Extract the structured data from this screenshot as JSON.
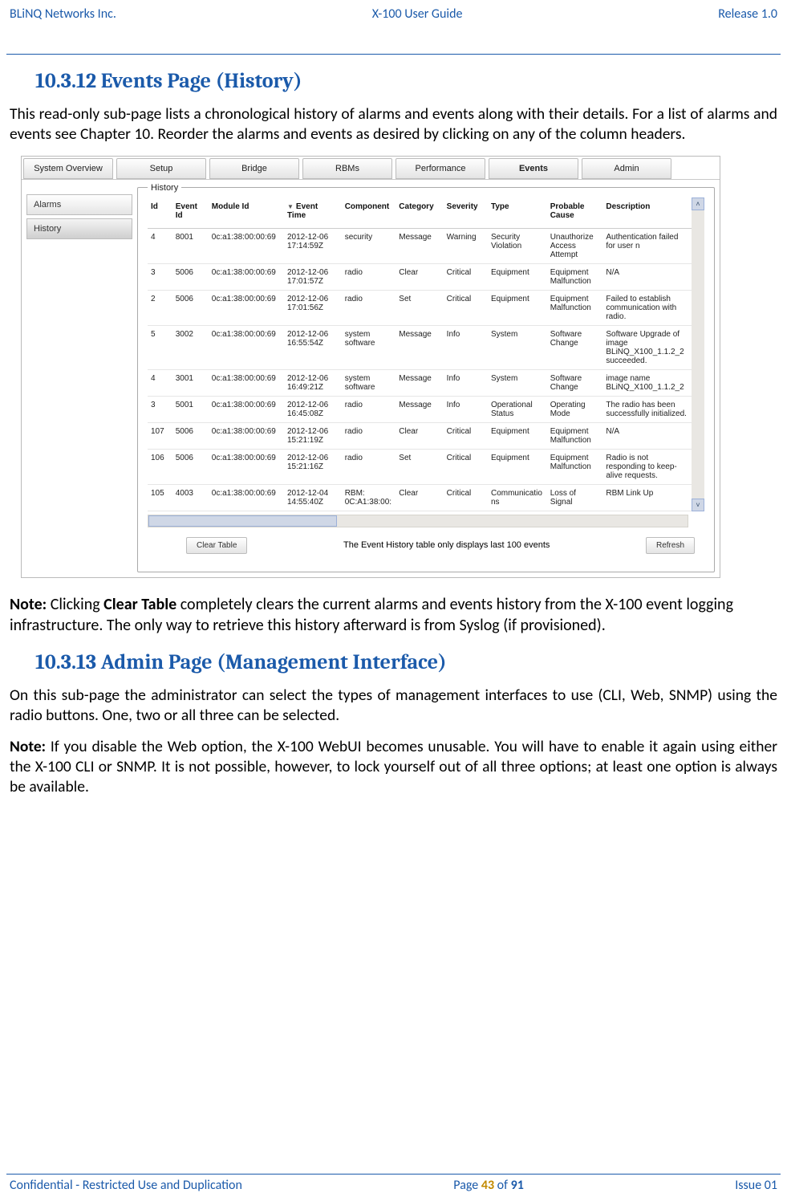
{
  "header": {
    "left": "BLiNQ Networks Inc.",
    "center": "X-100 User Guide",
    "right": "Release 1.0"
  },
  "footer": {
    "left": "Confidential - Restricted Use and Duplication",
    "page_label_pre": "Page ",
    "page_num": "43",
    "page_of": " of ",
    "page_total": "91",
    "right": "Issue 01"
  },
  "section1": {
    "heading": "10.3.12 Events Page (History)",
    "para": "This read-only sub-page lists a chronological history of alarms and events along with their details. For a list of alarms and events see Chapter 10. Reorder the alarms and events as desired by clicking on any of the column headers."
  },
  "note1": {
    "label": "Note:",
    "t1": " Clicking ",
    "bold1": "Clear Table",
    "t2": " completely clears the current alarms and events history from the X-100 event logging infrastructure. The only way to retrieve this history afterward is from Syslog (if provisioned)."
  },
  "section2": {
    "heading": "10.3.13 Admin Page (Management Interface)",
    "para": "On this sub-page the administrator can select the types of management interfaces to use (CLI, Web, SNMP) using the radio buttons. One, two or all three can be selected."
  },
  "note2": {
    "label": "Note:",
    "rest": " If you disable the Web option, the X-100 WebUI becomes unusable. You will have to enable it again using either the X-100 CLI or SNMP. It is not possible, however, to lock yourself out of all three options; at least one option is always be available."
  },
  "shot": {
    "tabs": [
      "System Overview",
      "Setup",
      "Bridge",
      "RBMs",
      "Performance",
      "Events",
      "Admin"
    ],
    "side": {
      "alarms": "Alarms",
      "history": "History"
    },
    "legend": "History",
    "cols": [
      "Id",
      "Event Id",
      "Module Id",
      "Event Time",
      "Component",
      "Category",
      "Severity",
      "Type",
      "Probable Cause",
      "Description"
    ],
    "rows": [
      {
        "id": "4",
        "eid": "8001",
        "mod": "0c:a1:38:00:00:69",
        "time": "2012-12-06 17:14:59Z",
        "comp": "security",
        "cat": "Message",
        "sev": "Warning",
        "type": "Security Violation",
        "pc": "Unauthorize Access Attempt",
        "desc": "Authentication failed for user n"
      },
      {
        "id": "3",
        "eid": "5006",
        "mod": "0c:a1:38:00:00:69",
        "time": "2012-12-06 17:01:57Z",
        "comp": "radio",
        "cat": "Clear",
        "sev": "Critical",
        "type": "Equipment",
        "pc": "Equipment Malfunction",
        "desc": "N/A"
      },
      {
        "id": "2",
        "eid": "5006",
        "mod": "0c:a1:38:00:00:69",
        "time": "2012-12-06 17:01:56Z",
        "comp": "radio",
        "cat": "Set",
        "sev": "Critical",
        "type": "Equipment",
        "pc": "Equipment Malfunction",
        "desc": "Failed to establish communication with radio."
      },
      {
        "id": "5",
        "eid": "3002",
        "mod": "0c:a1:38:00:00:69",
        "time": "2012-12-06 16:55:54Z",
        "comp": "system software",
        "cat": "Message",
        "sev": "Info",
        "type": "System",
        "pc": "Software Change",
        "desc": "Software Upgrade of image BLiNQ_X100_1.1.2_2 succeeded."
      },
      {
        "id": "4",
        "eid": "3001",
        "mod": "0c:a1:38:00:00:69",
        "time": "2012-12-06 16:49:21Z",
        "comp": "system software",
        "cat": "Message",
        "sev": "Info",
        "type": "System",
        "pc": "Software Change",
        "desc": "image name BLiNQ_X100_1.1.2_2"
      },
      {
        "id": "3",
        "eid": "5001",
        "mod": "0c:a1:38:00:00:69",
        "time": "2012-12-06 16:45:08Z",
        "comp": "radio",
        "cat": "Message",
        "sev": "Info",
        "type": "Operational Status",
        "pc": "Operating Mode",
        "desc": "The radio has been successfully initialized."
      },
      {
        "id": "107",
        "eid": "5006",
        "mod": "0c:a1:38:00:00:69",
        "time": "2012-12-06 15:21:19Z",
        "comp": "radio",
        "cat": "Clear",
        "sev": "Critical",
        "type": "Equipment",
        "pc": "Equipment Malfunction",
        "desc": "N/A"
      },
      {
        "id": "106",
        "eid": "5006",
        "mod": "0c:a1:38:00:00:69",
        "time": "2012-12-06 15:21:16Z",
        "comp": "radio",
        "cat": "Set",
        "sev": "Critical",
        "type": "Equipment",
        "pc": "Equipment Malfunction",
        "desc": "Radio is not responding to keep-alive requests."
      },
      {
        "id": "105",
        "eid": "4003",
        "mod": "0c:a1:38:00:00:69",
        "time": "2012-12-04 14:55:40Z",
        "comp": "RBM: 0C:A1:38:00:",
        "cat": "Clear",
        "sev": "Critical",
        "type": "Communications",
        "pc": "Loss of Signal",
        "desc": "RBM Link Up"
      }
    ],
    "clear_btn": "Clear Table",
    "foot_msg": "The Event History table only displays last 100 events",
    "refresh_btn": "Refresh"
  }
}
